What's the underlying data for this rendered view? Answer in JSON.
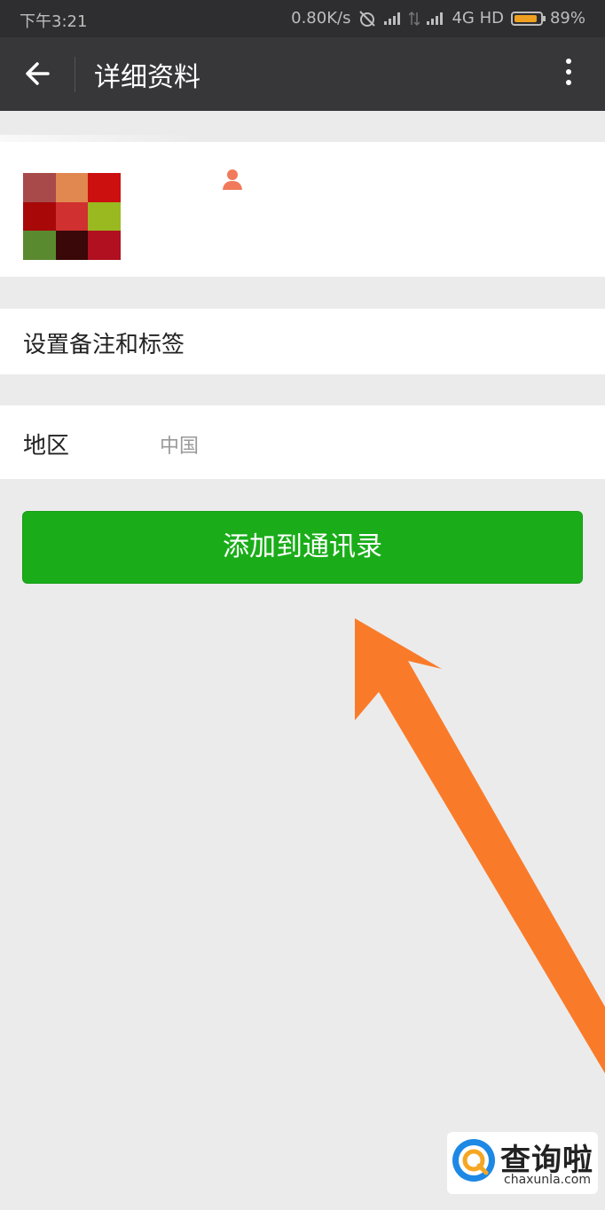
{
  "status_bar": {
    "time": "下午3:21",
    "net_speed": "0.80K/s",
    "network": "4G HD",
    "battery": "89%",
    "battery_level": 0.89
  },
  "nav": {
    "title": "详细资料"
  },
  "profile": {
    "avatar_colors": [
      "#a84a4a",
      "#e08850",
      "#cc1010",
      "#a80808",
      "#d03030",
      "#9ab820",
      "#5a8a30",
      "#3a0808",
      "#b01020"
    ],
    "gender_icon_color": "#f07a5a"
  },
  "remark_row": {
    "label": "设置备注和标签"
  },
  "region_row": {
    "label": "地区",
    "value": "中国"
  },
  "add_button": {
    "label": "添加到通讯录"
  },
  "annotation": {
    "arrow_color": "#f97b2a"
  },
  "watermark": {
    "title": "查询啦",
    "url": "chaxunla.com"
  }
}
